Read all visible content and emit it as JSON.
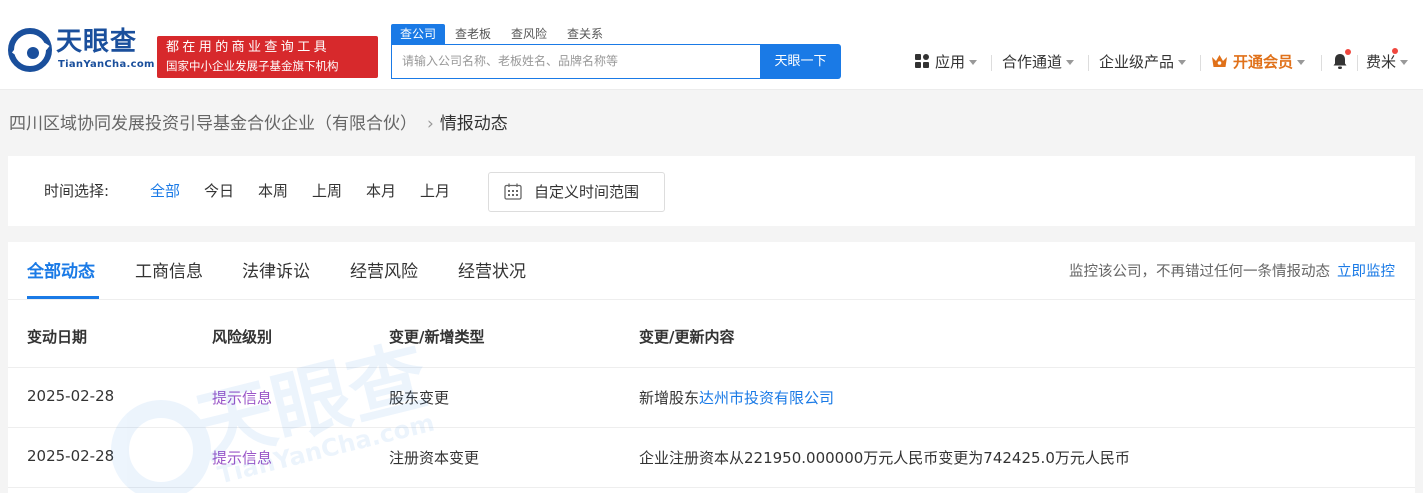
{
  "header": {
    "logo_cn": "天眼查",
    "logo_en": "TianYanCha.com",
    "slogan_line1": "都在用的商业查询工具",
    "slogan_line2": "国家中小企业发展子基金旗下机构",
    "search_tabs": [
      "查公司",
      "查老板",
      "查风险",
      "查关系"
    ],
    "search_placeholder": "请输入公司名称、老板姓名、品牌名称等",
    "search_button": "天眼一下",
    "nav": {
      "apps": "应用",
      "partner": "合作通道",
      "enterprise": "企业级产品",
      "vip": "开通会员",
      "user": "费米"
    }
  },
  "breadcrumb": {
    "company": "四川区域协同发展投资引导基金合伙企业（有限合伙）",
    "current": "情报动态"
  },
  "filter": {
    "label": "时间选择:",
    "options": [
      "全部",
      "今日",
      "本周",
      "上周",
      "本月",
      "上月"
    ],
    "custom_range": "自定义时间范围"
  },
  "tabs": [
    "全部动态",
    "工商信息",
    "法律诉讼",
    "经营风险",
    "经营状况"
  ],
  "monitor": {
    "text": "监控该公司，不再错过任何一条情报动态",
    "link": "立即监控"
  },
  "table": {
    "headers": [
      "变动日期",
      "风险级别",
      "变更/新增类型",
      "变更/更新内容"
    ],
    "rows": [
      {
        "date": "2025-02-28",
        "risk": "提示信息",
        "type": "股东变更",
        "content_prefix": "新增股东",
        "content_link": "达州市投资有限公司"
      },
      {
        "date": "2025-02-28",
        "risk": "提示信息",
        "type": "注册资本变更",
        "content_prefix": "企业注册资本从221950.000000万元人民币变更为742425.0万元人民币",
        "content_link": ""
      }
    ]
  },
  "colors": {
    "accent": "#1a7ae6",
    "slogan_bg": "#d7292c",
    "risk_hint": "#9a55c7",
    "vip": "#e0711a"
  }
}
